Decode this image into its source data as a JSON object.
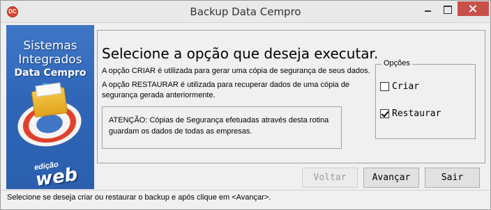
{
  "window": {
    "title": "Backup Data Cempro",
    "icon": "app-logo-icon"
  },
  "banner": {
    "line1": "Sistemas",
    "line2": "Integrados",
    "line3": "Data Cempro",
    "edition_small": "edição",
    "edition_big": "web"
  },
  "main": {
    "heading": "Selecione a opção que deseja executar.",
    "desc_criar": "A opção CRIAR é utilizada para gerar uma cópia de segurança de seus dados.",
    "desc_restaurar": "A opção RESTAURAR é utilizada para recuperar dados de uma cópia de segurança gerada anteriormente.",
    "warning": "ATENÇÃO: Cópias de Segurança efetuadas através desta rotina guardam os dados de todas as empresas."
  },
  "options": {
    "legend": "Opções",
    "criar": {
      "label": "Criar",
      "checked": false
    },
    "restaurar": {
      "label": "Restaurar",
      "checked": true
    }
  },
  "buttons": {
    "voltar": "Voltar",
    "avancar": "Avançar",
    "sair": "Sair"
  },
  "status": {
    "text": "Selecione se deseja criar ou restaurar o backup e após clique em <Avançar>."
  }
}
